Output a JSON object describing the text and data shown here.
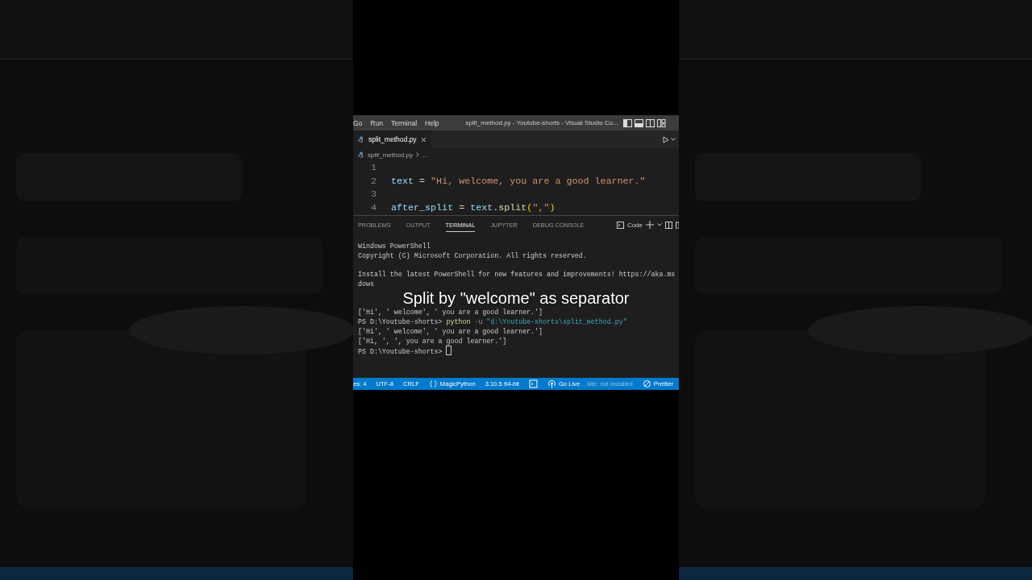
{
  "menu": [
    "Go",
    "Run",
    "Terminal",
    "Help"
  ],
  "window_title": "split_method.py - Youtube-shorts - Visual Studio Co...",
  "editor_tabs": [
    {
      "label": "split_method.py",
      "selected": true
    }
  ],
  "breadcrumb": [
    "split_method.py",
    "..."
  ],
  "code_lines": [
    {
      "number": "1"
    },
    {
      "number": "2",
      "tokens": [
        {
          "kind": "name",
          "text": "text"
        },
        {
          "kind": "op",
          "text": " = "
        },
        {
          "kind": "string",
          "text": "\"Hi, welcome, you are a good learner.\""
        }
      ]
    },
    {
      "number": "3"
    },
    {
      "number": "4",
      "tokens": [
        {
          "kind": "name",
          "text": "after_split"
        },
        {
          "kind": "op",
          "text": " = "
        },
        {
          "kind": "name",
          "text": "text"
        },
        {
          "kind": "op",
          "text": "."
        },
        {
          "kind": "func",
          "text": "split"
        },
        {
          "kind": "bracket",
          "text": "("
        },
        {
          "kind": "string",
          "text": "\",\""
        },
        {
          "kind": "bracket",
          "text": ")"
        }
      ]
    }
  ],
  "panel_tabs": [
    {
      "label": "PROBLEMS",
      "selected": false
    },
    {
      "label": "OUTPUT",
      "selected": false
    },
    {
      "label": "TERMINAL",
      "selected": true
    },
    {
      "label": "JUPYTER",
      "selected": false
    },
    {
      "label": "DEBUG CONSOLE",
      "selected": false
    }
  ],
  "terminal_profile": "Code",
  "terminal_lines": [
    {
      "kind": "plain",
      "text": "Windows PowerShell"
    },
    {
      "kind": "plain",
      "text": "Copyright (C) Microsoft Corporation. All rights reserved."
    },
    {
      "kind": "blank"
    },
    {
      "kind": "plain",
      "text": "Install the latest PowerShell for new features and improvements! https://aka.ms"
    },
    {
      "kind": "plain",
      "text": "dows"
    },
    {
      "kind": "caption",
      "text": "Split by \"welcome\" as separator"
    },
    {
      "kind": "plain",
      "text": "['Hi', ' welcome', ' you are a good learner.']"
    },
    {
      "kind": "command",
      "prompt": "PS D:\\Youtube-shorts>",
      "command": "python",
      "flag": "-u",
      "path": "\"d:\\Youtube-shorts\\split_method.py\""
    },
    {
      "kind": "plain",
      "text": "['Hi', ' welcome', ' you are a good learner.']"
    },
    {
      "kind": "plain",
      "text": "['Hi, ', ', you are a good learner.']"
    },
    {
      "kind": "prompt",
      "prompt": "PS D:\\Youtube-shorts>"
    }
  ],
  "status_items": [
    {
      "kind": "plain",
      "text": "es: 4"
    },
    {
      "kind": "plain",
      "text": "UTF-8"
    },
    {
      "kind": "plain",
      "text": "CRLF"
    },
    {
      "kind": "language",
      "text": "MagicPython"
    },
    {
      "kind": "plain",
      "text": "3.10.5 64-bit"
    },
    {
      "kind": "shell"
    },
    {
      "kind": "live",
      "text": "Go Live"
    },
    {
      "kind": "dimmed",
      "text": "kite: not installed"
    },
    {
      "kind": "prettier",
      "text": "Prettier"
    }
  ]
}
